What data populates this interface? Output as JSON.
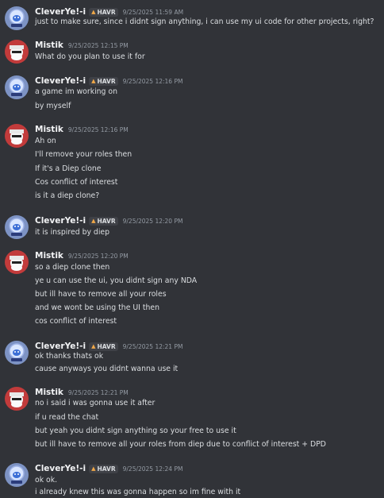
{
  "messages": [
    {
      "author": "CleverYe!-i",
      "tag": "HAVR",
      "tag_icon": "flame-icon",
      "time": "9/25/2025 11:59 AM",
      "lines": [
        "just to make sure, since i didnt sign anything, i can use my ui code for other projects, right?"
      ]
    },
    {
      "author": "Mistik",
      "time": "9/25/2025 12:15 PM",
      "lines": [
        "What do you plan to use it for"
      ]
    },
    {
      "author": "CleverYe!-i",
      "tag": "HAVR",
      "tag_icon": "flame-icon",
      "time": "9/25/2025 12:16 PM",
      "lines": [
        "a game im working on",
        "by myself"
      ]
    },
    {
      "author": "Mistik",
      "time": "9/25/2025 12:16 PM",
      "lines": [
        "Ah on",
        "I'll remove your roles then",
        "If it's a Diep clone",
        "Cos conflict of interest",
        "is it a diep clone?"
      ]
    },
    {
      "author": "CleverYe!-i",
      "tag": "HAVR",
      "tag_icon": "flame-icon",
      "time": "9/25/2025 12:20 PM",
      "lines": [
        "it is inspired by diep"
      ]
    },
    {
      "author": "Mistik",
      "time": "9/25/2025 12:20 PM",
      "lines": [
        "so a diep clone then",
        "ye u can use the ui, you didnt sign any NDA",
        "but ill have to remove all your roles",
        "and we wont be using the UI then",
        "cos conflict of interest"
      ]
    },
    {
      "author": "CleverYe!-i",
      "tag": "HAVR",
      "tag_icon": "flame-icon",
      "time": "9/25/2025 12:21 PM",
      "lines": [
        "ok thanks thats ok",
        "cause anyways you didnt wanna use it"
      ]
    },
    {
      "author": "Mistik",
      "time": "9/25/2025 12:21 PM",
      "lines": [
        "no i said i was gonna use it after",
        "if u read the chat",
        "but yeah you didnt sign anything so your free to use it",
        "but ill have to remove all your roles from diep due to conflict of interest + DPD"
      ]
    },
    {
      "author": "CleverYe!-i",
      "tag": "HAVR",
      "tag_icon": "flame-icon",
      "time": "9/25/2025 12:24 PM",
      "lines": [
        "ok ok.",
        "i already knew this was gonna happen so im fine with it"
      ]
    }
  ]
}
